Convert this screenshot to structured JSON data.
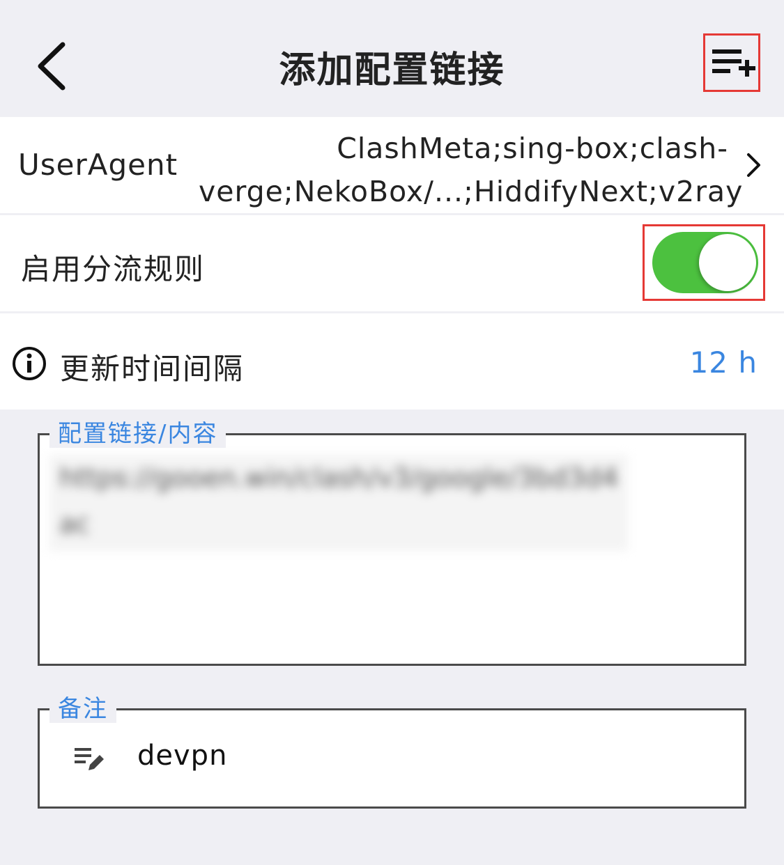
{
  "header": {
    "title": "添加配置链接",
    "back_icon": "chevron-left-icon",
    "add_icon": "playlist-add-icon"
  },
  "user_agent": {
    "label": "UserAgent",
    "value": "ClashMeta;sing-box;clash-verge;NekoBox/...;HiddifyNext;v2ray",
    "chevron_icon": "chevron-right-icon"
  },
  "split_rule": {
    "label": "启用分流规则",
    "enabled": true,
    "toggle_color": "#4cc13f"
  },
  "update_interval": {
    "label": "更新时间间隔",
    "value": "12 h",
    "icon": "info-icon"
  },
  "content_field": {
    "legend": "配置链接/内容",
    "value": "https://gooen.win/clash/v3/google/3bd3d4ac"
  },
  "remark_field": {
    "legend": "备注",
    "value": "devpn",
    "icon": "edit-note-icon"
  },
  "colors": {
    "accent": "#3a86e0",
    "highlight_border": "#e53935",
    "background": "#efeff4"
  }
}
